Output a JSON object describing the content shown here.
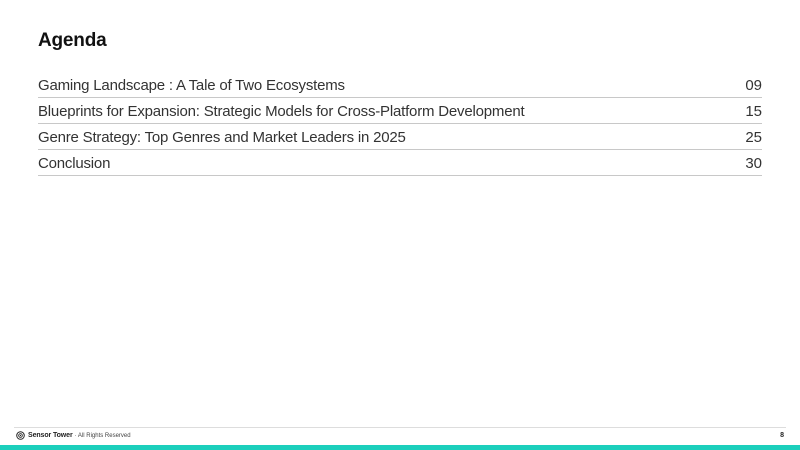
{
  "title": "Agenda",
  "agenda": [
    {
      "label": "Gaming Landscape : A Tale of Two Ecosystems",
      "page": "09"
    },
    {
      "label": "Blueprints for Expansion: Strategic Models for Cross-Platform Development",
      "page": "15"
    },
    {
      "label": "Genre Strategy: Top Genres and Market Leaders in 2025",
      "page": "25"
    },
    {
      "label": "Conclusion",
      "page": "30"
    }
  ],
  "footer": {
    "brand": "Sensor Tower",
    "rights": "· All Rights Reserved",
    "page_number": "8",
    "logo_icon": "sensor-tower-logo-icon"
  },
  "colors": {
    "accent": "#1ccfbc",
    "divider": "#c8c8c8",
    "text": "#333333"
  }
}
